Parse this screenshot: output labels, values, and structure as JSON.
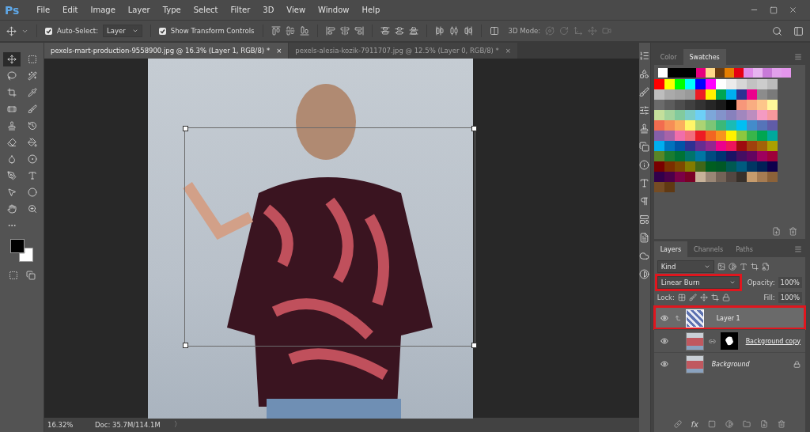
{
  "app": {
    "logo": "Ps"
  },
  "menu": [
    "File",
    "Edit",
    "Image",
    "Layer",
    "Type",
    "Select",
    "Filter",
    "3D",
    "View",
    "Window",
    "Help"
  ],
  "options_bar": {
    "auto_select": {
      "label": "Auto-Select:",
      "checked": true
    },
    "auto_select_target": "Layer",
    "show_transform": {
      "label": "Show Transform Controls",
      "checked": true
    },
    "mode_label": "3D Mode:"
  },
  "document_tabs": [
    {
      "label": "pexels-mart-production-9558900.jpg @ 16.3% (Layer 1, RGB/8) *",
      "close": "×",
      "selected": true
    },
    {
      "label": "pexels-alesia-kozik-7911707.jpg @ 12.5% (Layer 0, RGB/8) *",
      "close": "×",
      "selected": false
    }
  ],
  "tools": [
    {
      "selected": true
    },
    {
      "selected": false
    },
    {
      "selected": false
    },
    {
      "selected": false
    },
    {
      "selected": false
    },
    {
      "selected": false
    },
    {
      "selected": false
    },
    {
      "selected": false
    },
    {
      "selected": false
    },
    {
      "selected": false
    },
    {
      "selected": false
    },
    {
      "selected": false
    },
    {
      "selected": false
    },
    {
      "selected": false
    },
    {
      "selected": false
    },
    {
      "selected": false
    },
    {
      "selected": false
    },
    {
      "selected": false
    },
    {
      "selected": false
    },
    {
      "selected": false
    },
    {
      "selected": false
    }
  ],
  "status_bar": {
    "zoom": "16.32%",
    "doc": "Doc: 35.7M/114.1M",
    "arrow": "〉"
  },
  "swatches_panel": {
    "tabs": [
      {
        "label": "Color",
        "selected": false
      },
      {
        "label": "Swatches",
        "selected": true
      }
    ],
    "recent": [
      {
        "color": "#ffffff"
      },
      {
        "color": "#000000"
      },
      {
        "color": "#000000"
      },
      {
        "color": "#000000"
      },
      {
        "color": "#e6007e"
      },
      {
        "color": "#ffd98a"
      },
      {
        "color": "#6b3d10"
      },
      {
        "color": "#e67e00"
      },
      {
        "color": "#e60012"
      },
      {
        "color": "#e08ce8"
      },
      {
        "color": "#e8b4f0"
      },
      {
        "color": "#c87ad8"
      },
      {
        "color": "#e2a0ec"
      },
      {
        "color": "#e496ec"
      }
    ],
    "rows": [
      {
        "swatches": [
          {
            "color": "#ff0000"
          },
          {
            "color": "#ffff00"
          },
          {
            "color": "#00ff00"
          },
          {
            "color": "#00ffff"
          },
          {
            "color": "#0000ff"
          },
          {
            "color": "#ff00ff"
          },
          {
            "color": "#ffffff"
          },
          {
            "color": "#ebebeb"
          },
          {
            "color": "#d6d6d6"
          },
          {
            "color": "#c2c2c2"
          },
          {
            "color": "#cccccc"
          },
          {
            "color": "#bbbbbb"
          }
        ]
      },
      {
        "swatches": [
          {
            "color": "#bdbdbd"
          },
          {
            "color": "#aaaaaa"
          },
          {
            "color": "#a3a3a3"
          },
          {
            "color": "#9a9a9a"
          },
          {
            "color": "#ed1c24"
          },
          {
            "color": "#fff200"
          },
          {
            "color": "#00a651"
          },
          {
            "color": "#00aeef"
          },
          {
            "color": "#2e3192"
          },
          {
            "color": "#ec008c"
          },
          {
            "color": "#8c8c8c"
          },
          {
            "color": "#7a7a7a"
          }
        ]
      },
      {
        "swatches": [
          {
            "color": "#6b6b6b"
          },
          {
            "color": "#5c5c5c"
          },
          {
            "color": "#4d4d4d"
          },
          {
            "color": "#404040"
          },
          {
            "color": "#333333"
          },
          {
            "color": "#262626"
          },
          {
            "color": "#1a1a1a"
          },
          {
            "color": "#000000"
          },
          {
            "color": "#f7977a"
          },
          {
            "color": "#f9ad81"
          },
          {
            "color": "#fdc68a"
          },
          {
            "color": "#fff79a"
          }
        ]
      },
      {
        "swatches": [
          {
            "color": "#c4df9b"
          },
          {
            "color": "#a3d39c"
          },
          {
            "color": "#82ca9d"
          },
          {
            "color": "#7bcdc8"
          },
          {
            "color": "#6dcff6"
          },
          {
            "color": "#7da7d9"
          },
          {
            "color": "#8393ca"
          },
          {
            "color": "#8781bd"
          },
          {
            "color": "#a187be"
          },
          {
            "color": "#bc8dbf"
          },
          {
            "color": "#f49ac2"
          },
          {
            "color": "#f6989d"
          }
        ]
      },
      {
        "swatches": [
          {
            "color": "#f26c4f"
          },
          {
            "color": "#f68e56"
          },
          {
            "color": "#fbaf5d"
          },
          {
            "color": "#fff568"
          },
          {
            "color": "#acd373"
          },
          {
            "color": "#7cc576"
          },
          {
            "color": "#3bb878"
          },
          {
            "color": "#1abbb4"
          },
          {
            "color": "#00bff3"
          },
          {
            "color": "#438ccb"
          },
          {
            "color": "#5574b9"
          },
          {
            "color": "#605ca8"
          }
        ]
      },
      {
        "swatches": [
          {
            "color": "#855fa8"
          },
          {
            "color": "#a763a8"
          },
          {
            "color": "#f06eaa"
          },
          {
            "color": "#f26d7d"
          },
          {
            "color": "#ed1c24"
          },
          {
            "color": "#f26522"
          },
          {
            "color": "#f7941d"
          },
          {
            "color": "#fff200"
          },
          {
            "color": "#8dc73f"
          },
          {
            "color": "#39b54a"
          },
          {
            "color": "#00a651"
          },
          {
            "color": "#00a99d"
          }
        ]
      },
      {
        "swatches": [
          {
            "color": "#00aeef"
          },
          {
            "color": "#0072bc"
          },
          {
            "color": "#0054a6"
          },
          {
            "color": "#2e3192"
          },
          {
            "color": "#662d91"
          },
          {
            "color": "#92278f"
          },
          {
            "color": "#ec008c"
          },
          {
            "color": "#ed145b"
          },
          {
            "color": "#9e0b0f"
          },
          {
            "color": "#a0410d"
          },
          {
            "color": "#a36209"
          },
          {
            "color": "#aba000"
          }
        ]
      },
      {
        "swatches": [
          {
            "color": "#598527"
          },
          {
            "color": "#1a7b30"
          },
          {
            "color": "#007236"
          },
          {
            "color": "#00746b"
          },
          {
            "color": "#0076a3"
          },
          {
            "color": "#004b80"
          },
          {
            "color": "#003471"
          },
          {
            "color": "#1b1464"
          },
          {
            "color": "#440e62"
          },
          {
            "color": "#630460"
          },
          {
            "color": "#9e005d"
          },
          {
            "color": "#9e0039"
          }
        ]
      },
      {
        "swatches": [
          {
            "color": "#790000"
          },
          {
            "color": "#7b2e00"
          },
          {
            "color": "#7d4900"
          },
          {
            "color": "#827b00"
          },
          {
            "color": "#406618"
          },
          {
            "color": "#005e20"
          },
          {
            "color": "#005826"
          },
          {
            "color": "#005952"
          },
          {
            "color": "#005b7f"
          },
          {
            "color": "#003663"
          },
          {
            "color": "#002157"
          },
          {
            "color": "#0d004c"
          }
        ]
      },
      {
        "swatches": [
          {
            "color": "#32004b"
          },
          {
            "color": "#4b0049"
          },
          {
            "color": "#7b0046"
          },
          {
            "color": "#7a0026"
          },
          {
            "color": "#c7b299"
          },
          {
            "color": "#998675"
          },
          {
            "color": "#736357"
          },
          {
            "color": "#534741"
          },
          {
            "color": "#37302a"
          },
          {
            "color": "#c69c6d"
          },
          {
            "color": "#a67c52"
          },
          {
            "color": "#8c6239"
          }
        ]
      },
      {
        "swatches": [
          {
            "color": "#754c24"
          },
          {
            "color": "#603913"
          }
        ]
      }
    ]
  },
  "layers_panel": {
    "tabs": [
      {
        "label": "Layers",
        "selected": true
      },
      {
        "label": "Channels",
        "selected": false
      },
      {
        "label": "Paths",
        "selected": false
      }
    ],
    "filter": "Kind",
    "blend_mode": {
      "value": "Linear Burn",
      "highlighted": true
    },
    "opacity": {
      "label": "Opacity:",
      "value": "100%"
    },
    "lock_label": "Lock:",
    "fill": {
      "label": "Fill:",
      "value": "100%"
    },
    "layers": [
      {
        "name": "Layer 1",
        "kind": "smart",
        "visible": true,
        "selected": true,
        "clipped": true,
        "locked": false,
        "highlighted": true
      },
      {
        "name": "Background copy",
        "kind": "masked",
        "visible": true,
        "selected": false,
        "clipped": false,
        "locked": false,
        "highlighted": false
      },
      {
        "name": "Background",
        "kind": "background",
        "visible": true,
        "selected": false,
        "clipped": false,
        "locked": true,
        "highlighted": false
      }
    ],
    "fx": "fx"
  }
}
